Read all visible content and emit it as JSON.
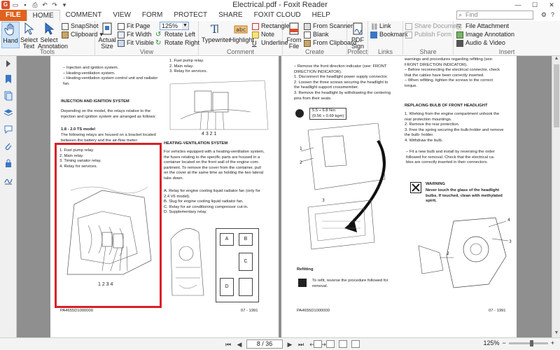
{
  "window": {
    "title": "Electrical.pdf - Foxit Reader"
  },
  "search": {
    "placeholder": "Find"
  },
  "tabs": [
    "FILE",
    "HOME",
    "COMMENT",
    "VIEW",
    "FORM",
    "PROTECT",
    "SHARE",
    "FOXIT CLOUD",
    "HELP"
  ],
  "ribbon": {
    "tools": {
      "label": "Tools",
      "hand": "Hand",
      "select_text": "Select\nText",
      "select_annotation": "Select\nAnnotation",
      "snapshot": "SnapShot",
      "clipboard": "Clipboard"
    },
    "view": {
      "label": "View",
      "actual_size": "Actual\nSize",
      "fit_page": "Fit Page",
      "fit_width": "Fit Width",
      "fit_visible": "Fit Visible",
      "zoom": "125%",
      "rotate_left": "Rotate Left",
      "rotate_right": "Rotate Right"
    },
    "comment": {
      "label": "Comment",
      "typewriter": "Typewriter",
      "highlight": "Highlight",
      "rectangle": "Rectangle",
      "note": "Note",
      "underline": "Underline"
    },
    "create": {
      "label": "Create",
      "from_file": "From\nFile",
      "from_scanner": "From Scanner",
      "blank": "Blank",
      "from_clipboard": "From Clipboard"
    },
    "protect": {
      "label": "Protect",
      "pdf_sign": "PDF\nSign"
    },
    "links": {
      "label": "Links",
      "link": "Link",
      "bookmark": "Bookmark"
    },
    "share": {
      "label": "Share",
      "share_document": "Share Document",
      "publish_form": "Publish Form"
    },
    "insert": {
      "label": "Insert",
      "file_attachment": "File Attachment",
      "image_annotation": "Image Annotation",
      "audio_video": "Audio & Video"
    }
  },
  "page1": {
    "left": {
      "items": [
        "–   Injection and ignition system.",
        "–   Heating-ventilation system.",
        "–   Heating-ventilation system control unit and radiator",
        "     fan."
      ],
      "heading": "INJECTION AND IGNITION SYSTEM",
      "para": [
        "Depending on the model, the relays relative to the",
        "injection and ignition system are arranged as follows:"
      ],
      "subheading": "1.8 - 2.0 TS model",
      "para2": [
        "The following relays are housed on a bracket located",
        "between the battery and the air-flow meter:"
      ],
      "relays": [
        "1.   Fuel pump relay.",
        "2.   Main relay.",
        "3.   Timing variator relay.",
        "4.   Relay for services."
      ],
      "callouts": "1   2   3   4",
      "footer": "PA4655D1000000"
    },
    "right": {
      "relays": [
        "1.   Fuel pump relay.",
        "2.   Main relay.",
        "3.   Relay for services."
      ],
      "callouts": "4   3   2   1",
      "heading": "HEATING-VENTILATION SYSTEM",
      "para": [
        "For vehicles equipped with a heating-ventilation system,",
        "the fuses relating to the specific parts are housed in a",
        "container located on the front wall of the engine com-",
        "partment. To remove the cover from the container, pull",
        "on the cover at the same time as holding the two lateral",
        "tabs down."
      ],
      "list": [
        "A.   Relay for engine cooling liquid radiator fan (only for",
        "      2.4 V6 model).",
        "B.   Slug for engine cooling liquid radiator fan.",
        "C.   Relay for air conditioning compressor cut-in.",
        "D.   Supplementary relay."
      ],
      "box_labels": [
        "A",
        "B",
        "C",
        "D"
      ],
      "footer": "07 - 1991"
    }
  },
  "page2": {
    "left": {
      "steps": [
        "–   Remove the front direction indicator (see: FRONT",
        "     DIRECTION INDICATOR).",
        "1.  Disconnect the headlight power supply connector.",
        "2.  Loosen the three screws securing the headlight to",
        "     the headlight support crossmember.",
        "3.  Remove the headlight by withdrawing the centering",
        "     pins from their seats."
      ],
      "torque": [
        "5.5 ÷ 6.8 Nm",
        "(0.56 ÷ 0.69 kgm)"
      ],
      "refitting_heading": "Refitting",
      "refitting_text": [
        "To refit, reverse the procedure followed for",
        "removal."
      ],
      "footer": "PA4655D1000000"
    },
    "right": {
      "intro": [
        "warnings and procedures regarding refitting (see:",
        "FRONT DIRECTION INDICATOR).",
        "–   Before reconnecting the electrical connector, check",
        "     that the cables have been correctly inserted.",
        "–   When refitting, tighten the screws to the correct",
        "     torque."
      ],
      "heading": "REPLACING BULB OF FRONT HEADLIGHT",
      "steps": [
        "1.  Working from the engine compartment unhook the",
        "     rear protection mountings.",
        "2.  Remove the rear protection.",
        "3.  Free the spring securing the bulb-holder and remove",
        "     the bulb- holder.",
        "4.  Withdraw the bulb."
      ],
      "fit_text": [
        "–   Fit a new bulb and install by reversing the order",
        "     followed for removal. Check that the electrical ca-",
        "     bles are correctly inserted in their connectors."
      ],
      "warning_title": "WARNING",
      "warning_text": [
        "Never touch the glass of the headlight",
        "bulbs. If touched, clean with methylated",
        "spirit."
      ],
      "footer": "07 - 1991"
    }
  },
  "status": {
    "page": "8 / 36",
    "zoom": "125%"
  }
}
